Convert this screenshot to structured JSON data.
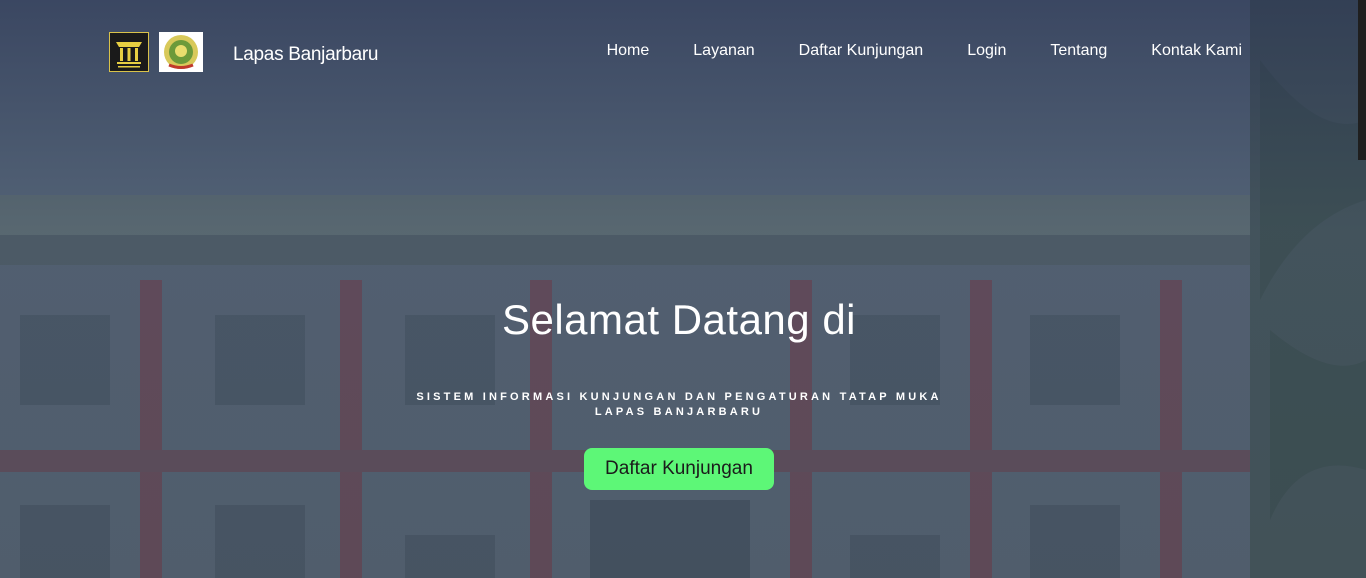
{
  "brand": {
    "name": "Lapas Banjarbaru",
    "logo1_icon": "pemasyarakatan-emblem-icon",
    "logo2_icon": "regional-seal-icon"
  },
  "nav": {
    "items": [
      {
        "label": "Home"
      },
      {
        "label": "Layanan"
      },
      {
        "label": "Daftar Kunjungan"
      },
      {
        "label": "Login"
      },
      {
        "label": "Tentang"
      },
      {
        "label": "Kontak Kami"
      }
    ]
  },
  "hero": {
    "title": "Selamat Datang di",
    "subtitle_line1": "SISTEM INFORMASI KUNJUNGAN DAN PENGATURAN TATAP MUKA",
    "subtitle_line2": "LAPAS BANJARBARU",
    "cta_label": "Daftar Kunjungan"
  },
  "colors": {
    "cta_bg": "#5df777",
    "overlay": "#2c3754",
    "text": "#ffffff"
  }
}
